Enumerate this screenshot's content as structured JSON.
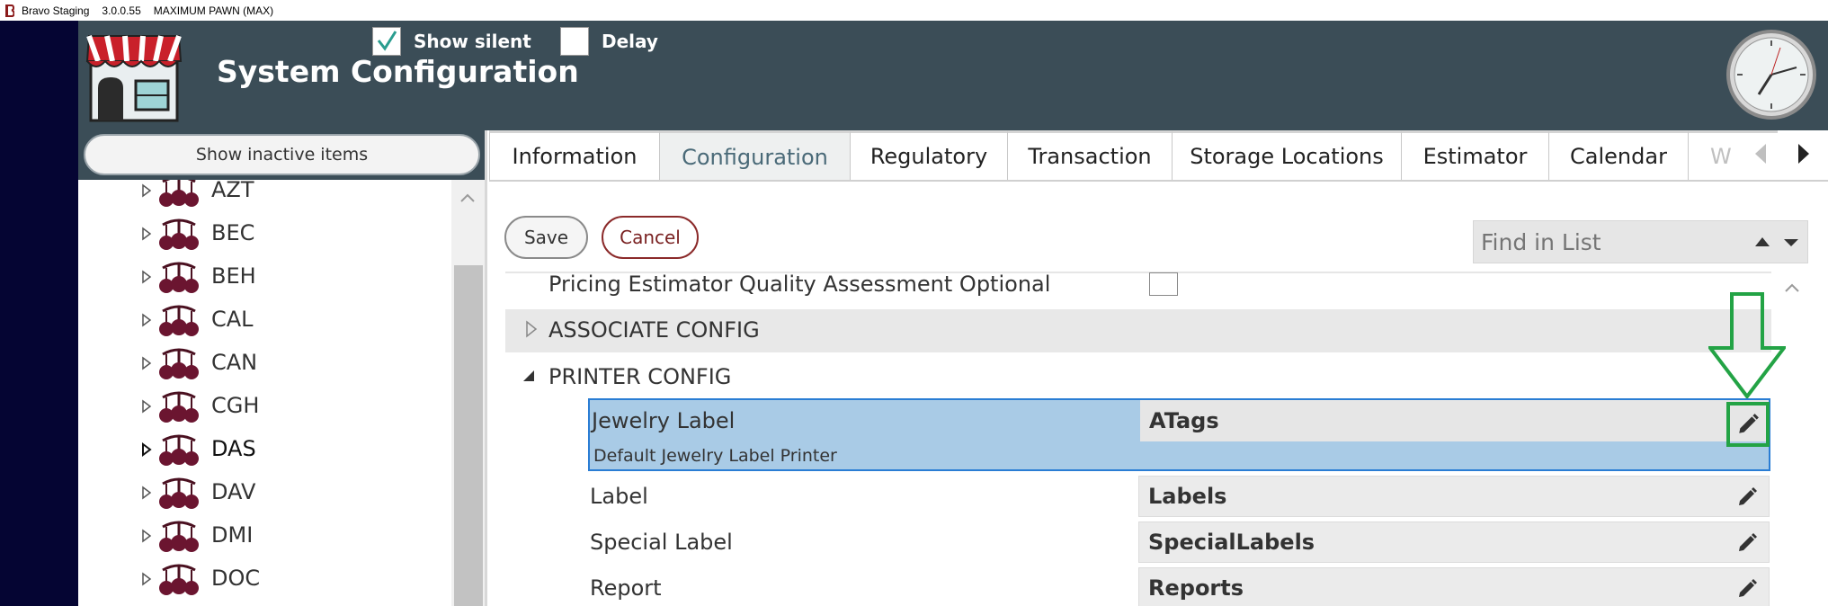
{
  "titlebar": {
    "app_name": "Bravo Staging",
    "version": "3.0.0.55",
    "store": "MAXIMUM PAWN (MAX)"
  },
  "header": {
    "title": "System Configuration",
    "show_silent_label": "Show silent",
    "show_silent_checked": true,
    "delay_label": "Delay",
    "delay_checked": false
  },
  "sidebar": {
    "show_inactive_label": "Show inactive items",
    "items": [
      {
        "code": "AZT"
      },
      {
        "code": "BEC"
      },
      {
        "code": "BEH"
      },
      {
        "code": "CAL"
      },
      {
        "code": "CAN"
      },
      {
        "code": "CGH"
      },
      {
        "code": "DAS"
      },
      {
        "code": "DAV"
      },
      {
        "code": "DMI"
      },
      {
        "code": "DOC"
      }
    ]
  },
  "tabs": [
    {
      "label": "Information"
    },
    {
      "label": "Configuration"
    },
    {
      "label": "Regulatory"
    },
    {
      "label": "Transaction"
    },
    {
      "label": "Storage Locations"
    },
    {
      "label": "Estimator"
    },
    {
      "label": "Calendar"
    },
    {
      "label": "W"
    }
  ],
  "toolbar": {
    "save_label": "Save",
    "cancel_label": "Cancel",
    "find_placeholder": "Find in List"
  },
  "grid": {
    "top_setting": "Pricing Estimator Quality Assessment Optional",
    "group_associate": "ASSOCIATE CONFIG",
    "group_printer": "PRINTER CONFIG",
    "selected": {
      "name": "Jewelry Label",
      "value": "ATags",
      "description": "Default Jewelry Label Printer"
    },
    "rows": [
      {
        "name": "Label",
        "value": "Labels"
      },
      {
        "name": "Special Label",
        "value": "SpecialLabels"
      },
      {
        "name": "Report",
        "value": "Reports"
      }
    ]
  },
  "colors": {
    "header_bg": "#3b4d57",
    "selection": "#a9cbe6",
    "highlight_green": "#23a345"
  }
}
